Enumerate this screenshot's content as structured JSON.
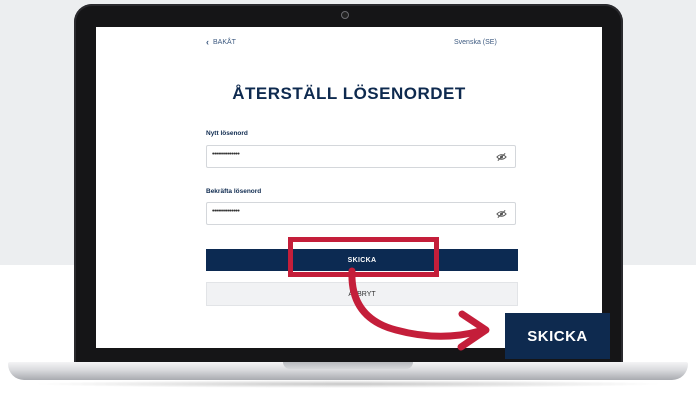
{
  "screen": {
    "back_label": "BAKÅT",
    "language": "Svenska (SE)",
    "title": "ÅTERSTÄLL LÖSENORDET",
    "fields": [
      {
        "label": "Nytt lösenord",
        "value": "••••••••••••••"
      },
      {
        "label": "Bekräfta lösenord",
        "value": "••••••••••••••"
      }
    ],
    "submit_label": "SKICKA",
    "cancel_label": "AVBRYT"
  },
  "callout": {
    "label": "SKICKA"
  },
  "colors": {
    "navy": "#0e2a4f",
    "highlight": "#c41e3a"
  },
  "icons": {
    "back": "chevron-left-icon",
    "password_toggle": "eye-slash-icon"
  }
}
